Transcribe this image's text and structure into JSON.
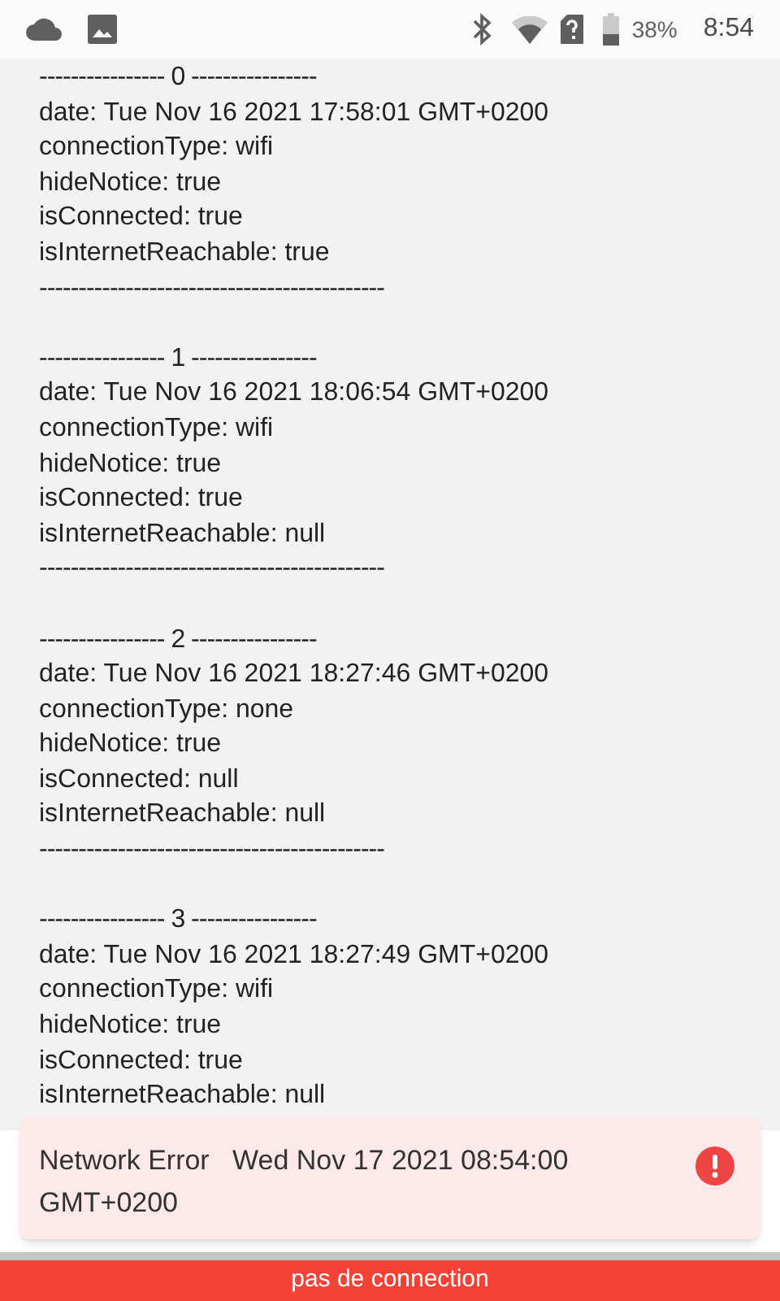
{
  "status_bar": {
    "battery": "38%",
    "time": "8:54"
  },
  "log_entries": [
    {
      "header": "---------------- 0 ----------------",
      "lines": [
        "date: Tue Nov 16 2021 17:58:01 GMT+0200",
        "connectionType: wifi",
        "hideNotice: true",
        "isConnected: true",
        "isInternetReachable: true"
      ],
      "footer": "--------------------------------------------"
    },
    {
      "header": "---------------- 1 ----------------",
      "lines": [
        "date: Tue Nov 16 2021 18:06:54 GMT+0200",
        "connectionType: wifi",
        "hideNotice: true",
        "isConnected: true",
        "isInternetReachable: null"
      ],
      "footer": "--------------------------------------------"
    },
    {
      "header": "---------------- 2 ----------------",
      "lines": [
        "date: Tue Nov 16 2021 18:27:46 GMT+0200",
        "connectionType: none",
        "hideNotice: true",
        "isConnected: null",
        "isInternetReachable: null"
      ],
      "footer": "--------------------------------------------"
    },
    {
      "header": "---------------- 3 ----------------",
      "lines": [
        "date: Tue Nov 16 2021 18:27:49 GMT+0200",
        "connectionType: wifi",
        "hideNotice: true",
        "isConnected: true",
        "isInternetReachable: null"
      ]
    }
  ],
  "toast": {
    "message": "Network Error   Wed Nov 17 2021 08:54:00 GMT+0200"
  },
  "offline_banner": "pas de connection"
}
